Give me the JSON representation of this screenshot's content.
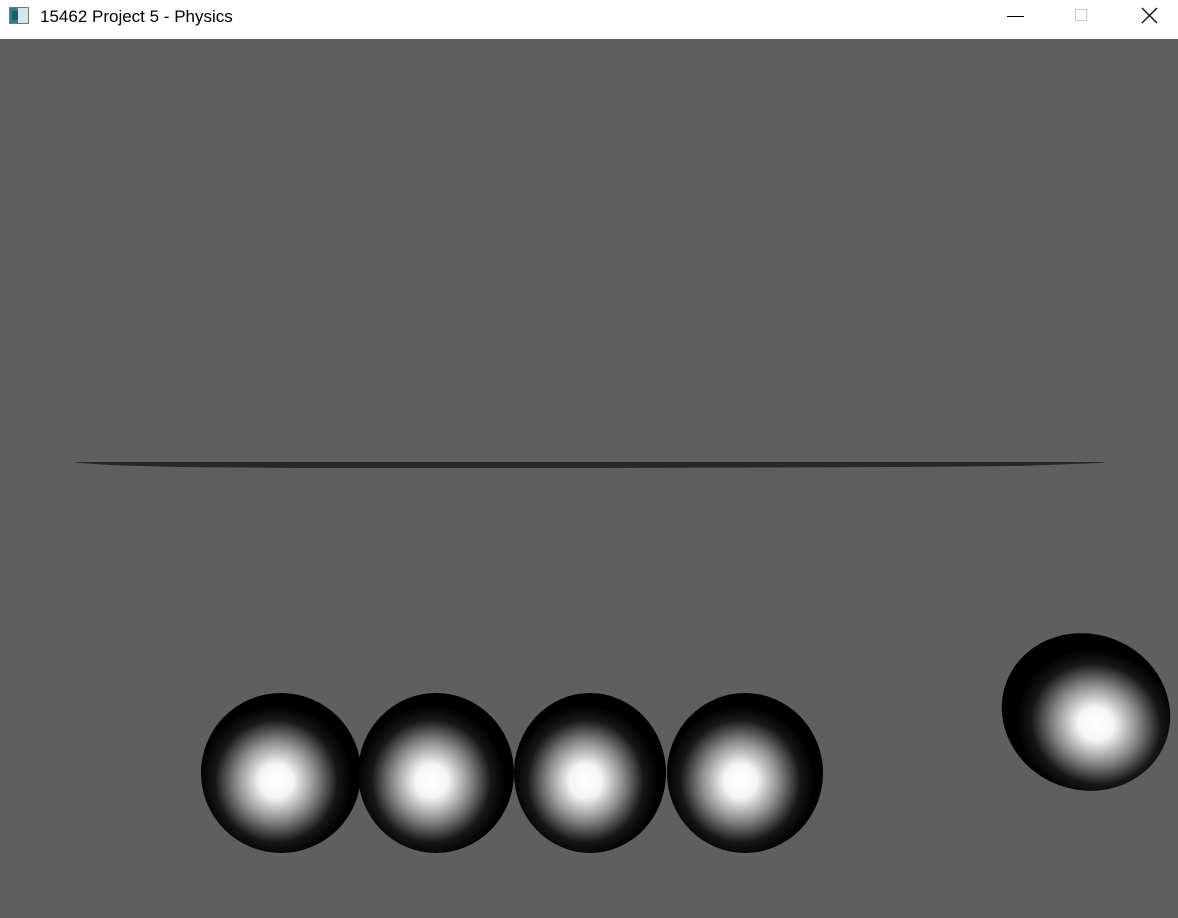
{
  "window": {
    "title": "15462 Project 5 - Physics",
    "app_icon": "app-window-icon",
    "controls": {
      "minimize_icon": "minimize-icon",
      "maximize_icon": "maximize-icon",
      "close_icon": "close-icon"
    }
  },
  "scene": {
    "background_color": "#5f5f5f",
    "plane_color": "#2b2724",
    "sphere_count": 5,
    "sphere_colors": {
      "highlight": "#ffffff",
      "shadow": "#000000"
    }
  }
}
